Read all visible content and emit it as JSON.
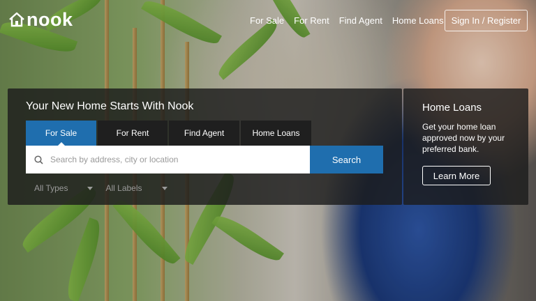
{
  "brand": {
    "name": "nook"
  },
  "nav": [
    "For Sale",
    "For Rent",
    "Find Agent",
    "Home Loans"
  ],
  "auth": {
    "label": "Sign In / Register"
  },
  "search_panel": {
    "title": "Your New Home Starts With Nook",
    "tabs": [
      "For Sale",
      "For Rent",
      "Find Agent",
      "Home Loans"
    ],
    "active_tab": "For Sale",
    "search_placeholder": "Search by address, city or location",
    "search_button": "Search",
    "filters": [
      "All Types",
      "All Labels"
    ]
  },
  "loans_card": {
    "title": "Home Loans",
    "text": "Get your home loan approved now by your preferred bank.",
    "button": "Learn More"
  },
  "colors": {
    "accent": "#1f6eae",
    "panel_bg": "#1c1c1c"
  }
}
